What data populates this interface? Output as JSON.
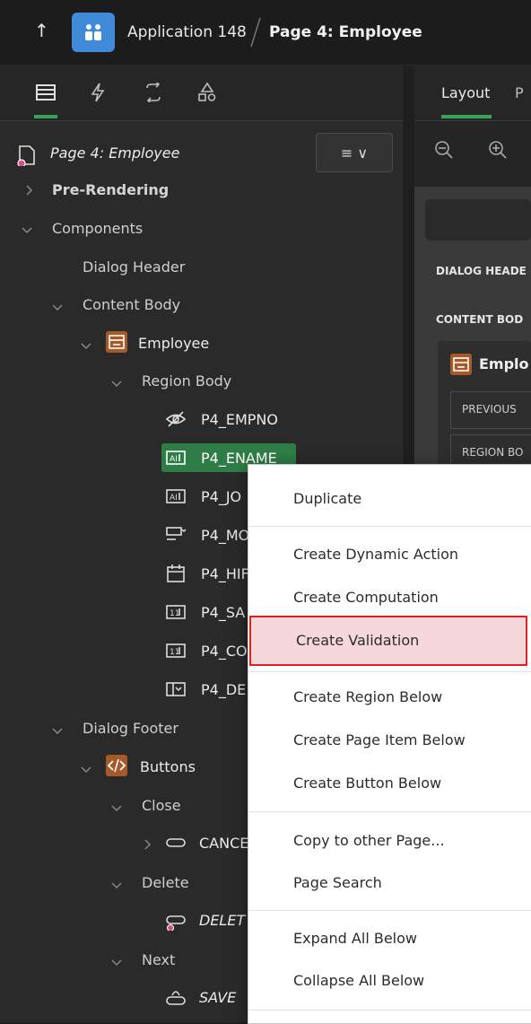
{
  "header": {
    "back_label": "↑",
    "app_title": "Application 148",
    "page_title": "Page 4: Employee"
  },
  "left_panel": {
    "tab_icons": [
      "rendering-icon",
      "dynamic-actions-icon",
      "processing-icon",
      "shared-components-icon"
    ],
    "page_node": "Page 4: Employee",
    "menu_button": "≡ ∨",
    "tree": {
      "pre_rendering": "Pre-Rendering",
      "components": "Components",
      "dialog_header": "Dialog Header",
      "content_body": "Content Body",
      "employee": "Employee",
      "region_body": "Region Body",
      "items": [
        "P4_EMPNO",
        "P4_ENAME",
        "P4_JO",
        "P4_MO",
        "P4_HIF",
        "P4_SA",
        "P4_CO",
        "P4_DE"
      ],
      "dialog_footer": "Dialog Footer",
      "buttons": "Buttons",
      "close": "Close",
      "cancel": "CANCE",
      "delete": "Delete",
      "delete_btn": "DELET",
      "next": "Next",
      "save": "SAVE"
    }
  },
  "right_panel": {
    "tab_layout": "Layout",
    "tab_second": "P",
    "dialog_header": "DIALOG HEADE",
    "content_body": "CONTENT BOD",
    "employee": "Emplo",
    "previous": "PREVIOUS",
    "region_body": "REGION BO"
  },
  "context_menu": {
    "items": [
      "Duplicate",
      "Create Dynamic Action",
      "Create Computation",
      "Create Validation",
      "Create Region Below",
      "Create Page Item Below",
      "Create Button Below",
      "Copy to other Page...",
      "Page Search",
      "Expand All Below",
      "Collapse All Below"
    ],
    "highlighted": "Create Validation"
  },
  "colors": {
    "accent_green": "#3aa05a",
    "region_orange": "#a65a2a",
    "highlight_border": "#e02020",
    "highlight_fill": "#f6d8dc",
    "app_icon_blue": "#3f8ad9"
  }
}
